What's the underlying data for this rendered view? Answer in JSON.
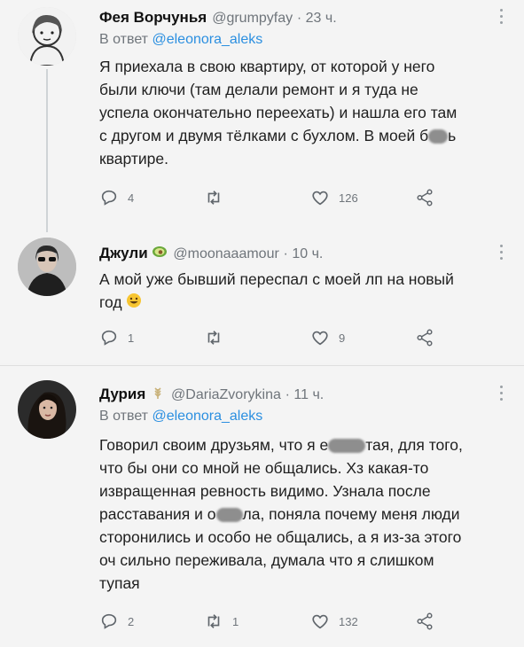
{
  "colors": {
    "link": "#2b8fe0",
    "muted": "#6f757b",
    "text": "#1f1f1f"
  },
  "tweets": [
    {
      "name": "Фея Ворчунья",
      "handle": "@grumpyfay",
      "time": "· 23 ч.",
      "reply_prefix": "В ответ",
      "reply_to": "@eleonora_aleks",
      "text_lines": [
        "Я приехала в свою квартиру, от которой у него",
        "были ключи (там делали ремонт и я туда не",
        "успела окончательно переехать) и нашла его там",
        "с другом и двумя тёлками с бухлом. В моей б",
        "ь",
        "квартире."
      ],
      "replies": "4",
      "retweets": "",
      "likes": "126",
      "icons": [
        "reply-icon",
        "retweet-icon",
        "like-icon",
        "share-icon",
        "more-icon"
      ]
    },
    {
      "name": "Джули",
      "handle": "@moonaaamour",
      "time": "· 10 ч.",
      "text_lines": [
        "А мой уже бывший переспал с моей лп на новый",
        "год"
      ],
      "replies": "1",
      "retweets": "",
      "likes": "9",
      "icons": [
        "avocado-icon",
        "smiley-icon",
        "reply-icon",
        "retweet-icon",
        "like-icon",
        "share-icon",
        "more-icon"
      ]
    },
    {
      "name": "Дурия",
      "handle": "@DariaZvorykina",
      "time": "· 11 ч.",
      "reply_prefix": "В ответ",
      "reply_to": "@eleonora_aleks",
      "text_lines": [
        "Говорил своим друзьям, что я е",
        "тая, для того,",
        "что бы они со мной не общались. Хз какая-то",
        "извращенная ревность видимо. Узнала после",
        "расставания и о",
        "ла, поняла почему меня люди",
        "сторонились и особо не общались, а я из-за этого",
        "оч сильно переживала, думала что я слишком",
        "тупая"
      ],
      "replies": "2",
      "retweets": "1",
      "likes": "132",
      "icons": [
        "wheat-icon",
        "reply-icon",
        "retweet-icon",
        "like-icon",
        "share-icon",
        "more-icon"
      ]
    }
  ]
}
